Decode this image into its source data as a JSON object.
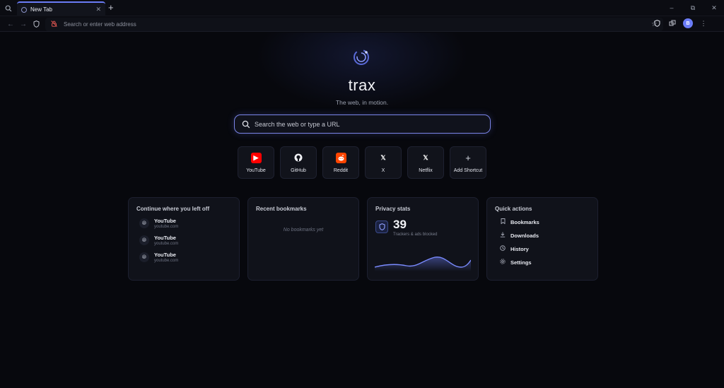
{
  "tab": {
    "title": "New Tab"
  },
  "address_bar": {
    "placeholder": "Search or enter web address"
  },
  "profile": {
    "initial": "B"
  },
  "hero": {
    "brand": "trax",
    "tagline": "The web, in motion."
  },
  "search": {
    "placeholder": "Search the web or type a URL"
  },
  "shortcuts": [
    {
      "label": "YouTube",
      "icon": "youtube-icon",
      "color": "#ff0000"
    },
    {
      "label": "GitHub",
      "icon": "github-icon",
      "color": "#1a1d27"
    },
    {
      "label": "Reddit",
      "icon": "reddit-icon",
      "color": "#ff4500"
    },
    {
      "label": "X",
      "icon": "x-icon",
      "color": "#1a1d27"
    },
    {
      "label": "Netflix",
      "icon": "x-icon",
      "color": "#1a1d27"
    },
    {
      "label": "Add Shortcut",
      "icon": "plus-icon",
      "color": "#1a1d27"
    }
  ],
  "continue": {
    "title": "Continue where you left off",
    "items": [
      {
        "name": "YouTube",
        "url": "youtube.com"
      },
      {
        "name": "YouTube",
        "url": "youtube.com"
      },
      {
        "name": "YouTube",
        "url": "youtube.com"
      }
    ]
  },
  "bookmarks": {
    "title": "Recent bookmarks",
    "empty": "No bookmarks yet"
  },
  "privacy": {
    "title": "Privacy stats",
    "count": "39",
    "label": "Trackers & ads blocked"
  },
  "quick_actions": {
    "title": "Quick actions",
    "items": [
      {
        "label": "Bookmarks",
        "icon": "bookmark-icon"
      },
      {
        "label": "Downloads",
        "icon": "download-icon"
      },
      {
        "label": "History",
        "icon": "history-icon"
      },
      {
        "label": "Settings",
        "icon": "settings-icon"
      }
    ]
  },
  "colors": {
    "accent": "#6b7cf6",
    "background": "#07080d",
    "card": "#10121a"
  }
}
